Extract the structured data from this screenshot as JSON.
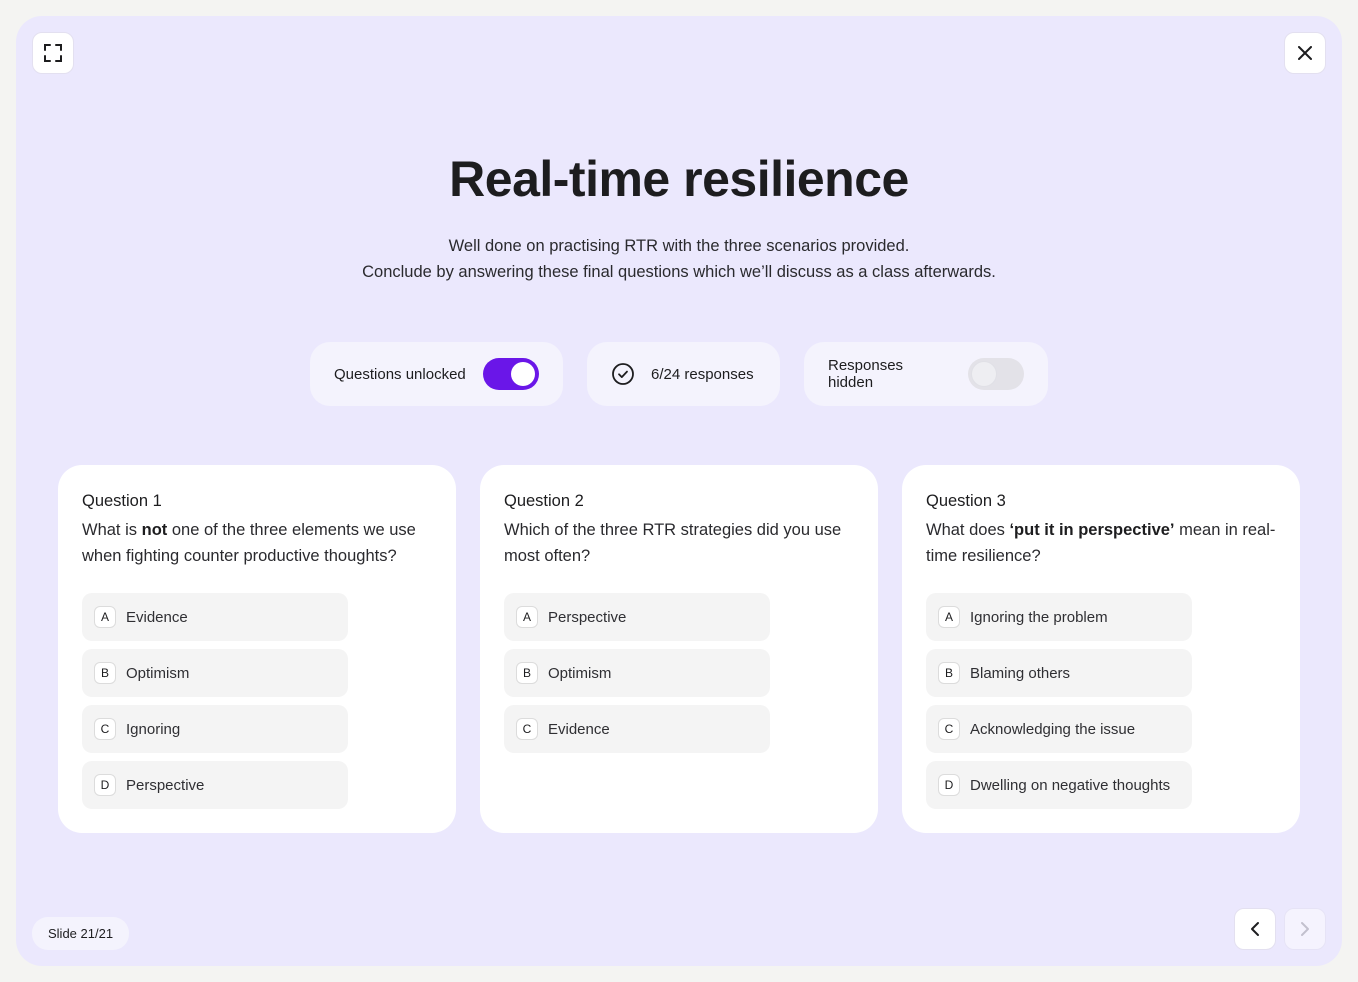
{
  "header": {
    "fullscreen_icon": "expand-corners-icon",
    "close_icon": "close-x-icon"
  },
  "title": "Real-time resilience",
  "subtitle": {
    "line1": "Well done on practising RTR with the three scenarios provided.",
    "line2": "Conclude by answering these final questions which we’ll discuss as a class afterwards."
  },
  "controls": {
    "questions_unlocked": {
      "label": "Questions unlocked",
      "state": true
    },
    "responses": {
      "icon": "check-circle-icon",
      "text": "6/24 responses"
    },
    "responses_hidden": {
      "label": "Responses hidden",
      "state": false
    }
  },
  "questions": [
    {
      "label": "Question 1",
      "text_before": "What is ",
      "text_bold": "not",
      "text_after": " one of the three elements we use when fighting counter productive thoughts?",
      "options": [
        {
          "letter": "A",
          "text": "Evidence"
        },
        {
          "letter": "B",
          "text": "Optimism"
        },
        {
          "letter": "C",
          "text": "Ignoring"
        },
        {
          "letter": "D",
          "text": "Perspective"
        }
      ]
    },
    {
      "label": "Question 2",
      "text_before": "Which of the three RTR strategies did you use most often?",
      "text_bold": "",
      "text_after": "",
      "options": [
        {
          "letter": "A",
          "text": "Perspective"
        },
        {
          "letter": "B",
          "text": "Optimism"
        },
        {
          "letter": "C",
          "text": "Evidence"
        }
      ]
    },
    {
      "label": "Question 3",
      "text_before": "What does ",
      "text_bold": "‘put it in perspective’",
      "text_after": " mean in real-time resilience?",
      "options": [
        {
          "letter": "A",
          "text": "Ignoring the problem"
        },
        {
          "letter": "B",
          "text": "Blaming others"
        },
        {
          "letter": "C",
          "text": "Acknowledging the issue"
        },
        {
          "letter": "D",
          "text": "Dwelling on negative thoughts"
        }
      ]
    }
  ],
  "footer": {
    "slide_label": "Slide 21/21",
    "prev_icon": "chevron-left-icon",
    "next_icon": "chevron-right-icon"
  },
  "colors": {
    "stage_bg": "#ebe8fd",
    "accent": "#6a16e8"
  }
}
